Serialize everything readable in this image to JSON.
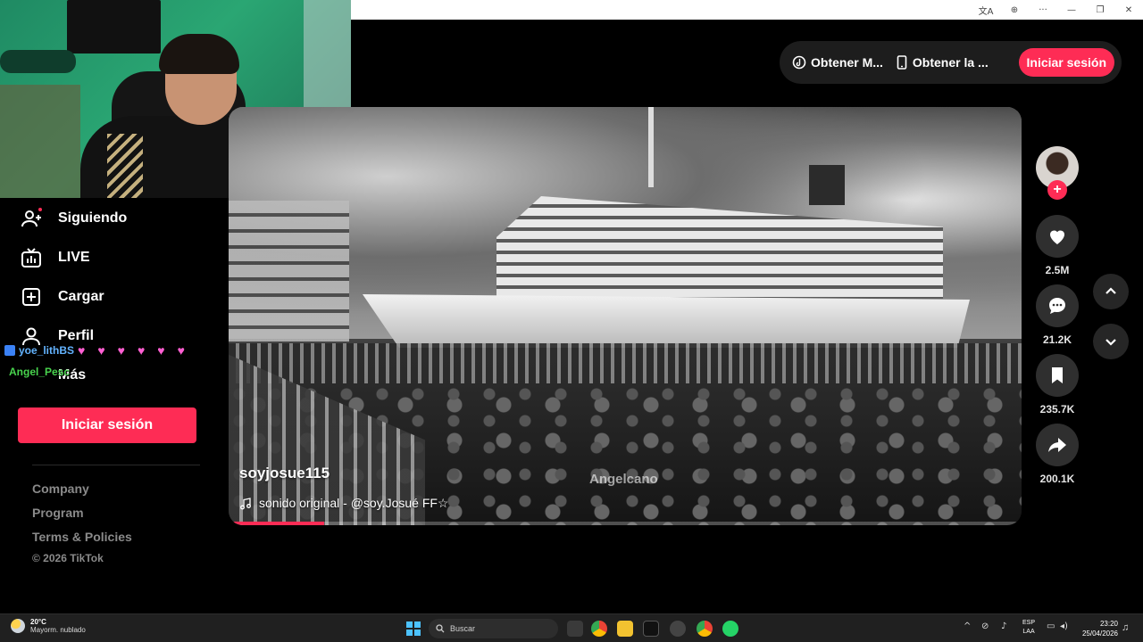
{
  "browser": {
    "icons": [
      "translate-icon",
      "zoom-icon",
      "more-icon",
      "minimize-icon",
      "restore-icon",
      "close-icon"
    ],
    "glyphs": [
      "文A",
      "⊕",
      "···",
      "—",
      "❐",
      "✕"
    ]
  },
  "sidebar": {
    "items": [
      {
        "label": "Siguiendo",
        "icon": "following-icon"
      },
      {
        "label": "LIVE",
        "icon": "live-icon"
      },
      {
        "label": "Cargar",
        "icon": "upload-icon"
      },
      {
        "label": "Perfil",
        "icon": "profile-icon"
      },
      {
        "label": "Más",
        "icon": "more-icon"
      }
    ],
    "login_label": "Iniciar sesión",
    "footer_links": [
      "Company",
      "Program",
      "Terms & Policies"
    ],
    "copyright": "© 2026 TikTok"
  },
  "chat": {
    "lines": [
      {
        "user": "yoe_lithBS",
        "emotes": "♥♥♥♥♥♥"
      },
      {
        "user": "Angel_Pesc",
        "emotes": ""
      }
    ]
  },
  "header": {
    "get_app_label": "Obtener M...",
    "get_phone_label": "Obtener la ...",
    "login_label": "Iniciar sesión"
  },
  "video": {
    "author": "soyjosue115",
    "sound": "sonido original - @soy.Josué FF☆",
    "watermark": "Angelcano",
    "progress": 0.12
  },
  "actions": {
    "likes": "2.5M",
    "comments": "21.2K",
    "saves": "235.7K",
    "shares": "200.1K"
  },
  "taskbar": {
    "weather_temp": "20°C",
    "weather_desc": "Mayorm. nublado",
    "search_placeholder": "Buscar",
    "lang_line1": "ESP",
    "lang_line2": "LAA",
    "time": "23:20",
    "date": "25/04/2026",
    "colors": {
      "accent": "#fe2c55",
      "windows": "#4cc2ff"
    }
  }
}
